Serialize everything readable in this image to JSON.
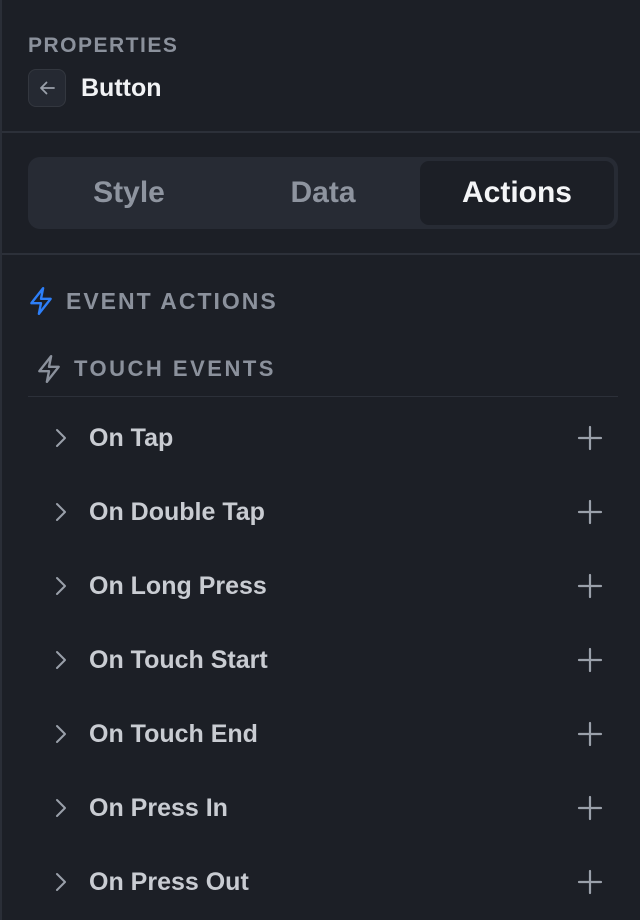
{
  "header": {
    "section_label": "PROPERTIES",
    "component_name": "Button"
  },
  "tabs": [
    {
      "label": "Style",
      "active": false
    },
    {
      "label": "Data",
      "active": false
    },
    {
      "label": "Actions",
      "active": true
    }
  ],
  "event_actions": {
    "title": "EVENT ACTIONS",
    "icon": "lightning-icon",
    "accent_color": "#2d7ff9"
  },
  "touch_events": {
    "title": "TOUCH EVENTS",
    "icon": "lightning-outline-icon",
    "items": [
      {
        "label": "On Tap"
      },
      {
        "label": "On Double Tap"
      },
      {
        "label": "On Long Press"
      },
      {
        "label": "On Touch Start"
      },
      {
        "label": "On Touch End"
      },
      {
        "label": "On Press In"
      },
      {
        "label": "On Press Out"
      }
    ]
  }
}
